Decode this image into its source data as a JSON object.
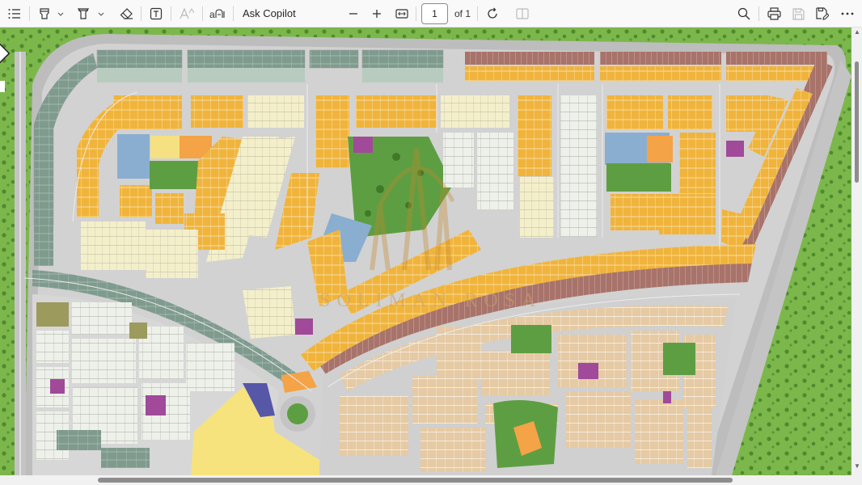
{
  "toolbar": {
    "contents_icon": "list-icon",
    "highlight_icon": "highlighter-icon",
    "draw_icon": "draw-pen-icon",
    "erase_icon": "eraser-icon",
    "text_box_icon": "text-box-icon",
    "text_size_icon": "text-size-icon",
    "read_aloud_icon": "read-aloud-icon",
    "ask_copilot_label": "Ask Copilot",
    "zoom_out_icon": "minus-icon",
    "zoom_in_icon": "plus-icon",
    "fit_icon": "fit-width-icon",
    "page_value": "1",
    "page_total_label": "of 1",
    "rotate_icon": "rotate-icon",
    "page_view_icon": "page-view-icon",
    "search_icon": "search-icon",
    "print_icon": "print-icon",
    "save_icon": "save-icon",
    "save_as_icon": "save-as-icon",
    "more_icon": "more-icon"
  },
  "document": {
    "watermark_text": "SOLIMAN ROSA",
    "colors": {
      "background_green": "#7bb84a",
      "road": "#c9c9c9",
      "yellow_plots": "#f0b43c",
      "cream_plots": "#f3eec8",
      "tan_plots": "#e2c9a5",
      "brown_plots": "#a87368",
      "grey_green_plots": "#7e9a8d",
      "blue_lake": "#8aaed0",
      "orange_plots": "#f4a347",
      "purple_plots": "#a04a99",
      "park_green": "#5e9e42"
    }
  },
  "scrollbars": {
    "vertical_position": 0.02,
    "horizontal_position": 0.11
  }
}
